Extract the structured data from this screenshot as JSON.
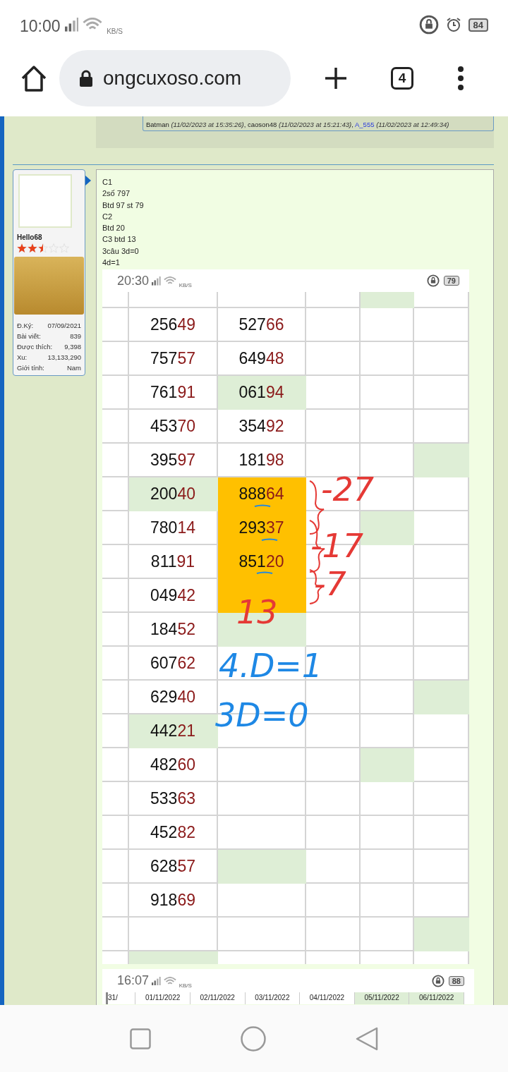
{
  "status_bar": {
    "time": "10:00",
    "speed_unit": "KB/S",
    "battery": "84"
  },
  "browser": {
    "url": "ongcuxoso.com",
    "tab_count": "4"
  },
  "likes": [
    {
      "user": "Batman",
      "time": "(11/02/2023 at 15:35:26)",
      "after": ",",
      "link": false
    },
    {
      "user": "caoson48",
      "time": "(11/02/2023 at 15:21:43)",
      "after": ",",
      "link": false
    },
    {
      "user": "A_555",
      "time": "(11/02/2023 at 12:49:34)",
      "link": true
    }
  ],
  "user": {
    "name": "Hello68",
    "stars": 2.5,
    "stats": [
      {
        "label": "Đ.Ký:",
        "value": "07/09/2021"
      },
      {
        "label": "Bài viết:",
        "value": "839"
      },
      {
        "label": "Được thích:",
        "value": "9,398"
      },
      {
        "label": "Xu:",
        "value": "13,133,290"
      },
      {
        "label": "Giới tính:",
        "value": "Nam"
      }
    ]
  },
  "post": {
    "lines": [
      "C1",
      "2số 797",
      "Btd 97 st 79",
      "C2",
      "Btd 20",
      "C3 btd 13",
      "3câu 3d=0",
      "4d=1"
    ],
    "screenshot": {
      "time": "20:30",
      "speed_unit": "KB/S",
      "battery": "79",
      "rows": [
        {
          "kind": "partial",
          "cells": [
            {},
            {},
            {},
            {
              "color": "#deeed6"
            },
            {}
          ]
        },
        {
          "kind": "full",
          "cells": [
            {
              "text": "25649"
            },
            {
              "text": "52766"
            },
            {},
            {},
            {}
          ]
        },
        {
          "kind": "full",
          "cells": [
            {
              "text": "75757"
            },
            {
              "text": "64948"
            },
            {},
            {},
            {}
          ]
        },
        {
          "kind": "full",
          "cells": [
            {
              "text": "76191"
            },
            {
              "text": "06194",
              "color": "#deeed6"
            },
            {},
            {},
            {}
          ]
        },
        {
          "kind": "full",
          "cells": [
            {
              "text": "45370"
            },
            {
              "text": "35492"
            },
            {},
            {},
            {}
          ]
        },
        {
          "kind": "full",
          "cells": [
            {
              "text": "39597"
            },
            {
              "text": "18198"
            },
            {},
            {},
            {
              "color": "#deeed6"
            }
          ]
        },
        {
          "kind": "full",
          "cells": [
            {
              "text": "20040",
              "color": "#deeed6"
            },
            {
              "text": "88864",
              "color": "#ffc000"
            },
            {},
            {},
            {}
          ]
        },
        {
          "kind": "full",
          "cells": [
            {
              "text": "78014"
            },
            {
              "text": "29337",
              "color": "#ffc000"
            },
            {},
            {
              "color": "#deeed6"
            },
            {}
          ]
        },
        {
          "kind": "full",
          "cells": [
            {
              "text": "81191"
            },
            {
              "text": "85120",
              "color": "#ffc000"
            },
            {},
            {},
            {}
          ]
        },
        {
          "kind": "full",
          "cells": [
            {
              "text": "04942"
            },
            {
              "color": "#ffc000"
            },
            {},
            {},
            {}
          ]
        },
        {
          "kind": "full",
          "cells": [
            {
              "text": "18452"
            },
            {
              "color": "#deeed6"
            },
            {},
            {},
            {}
          ]
        },
        {
          "kind": "full",
          "cells": [
            {
              "text": "60762"
            },
            {},
            {},
            {},
            {}
          ]
        },
        {
          "kind": "full",
          "cells": [
            {
              "text": "62940"
            },
            {},
            {},
            {},
            {
              "color": "#deeed6"
            }
          ]
        },
        {
          "kind": "full",
          "cells": [
            {
              "text": "44221",
              "color": "#deeed6"
            },
            {},
            {},
            {},
            {}
          ]
        },
        {
          "kind": "full",
          "cells": [
            {
              "text": "48260"
            },
            {},
            {},
            {
              "color": "#deeed6"
            },
            {}
          ]
        },
        {
          "kind": "full",
          "cells": [
            {
              "text": "53363"
            },
            {},
            {},
            {},
            {}
          ]
        },
        {
          "kind": "full",
          "cells": [
            {
              "text": "45282"
            },
            {},
            {},
            {},
            {}
          ]
        },
        {
          "kind": "full",
          "cells": [
            {
              "text": "62857"
            },
            {
              "color": "#deeed6"
            },
            {},
            {},
            {}
          ]
        },
        {
          "kind": "full",
          "cells": [
            {
              "text": "91869"
            },
            {},
            {},
            {},
            {}
          ]
        },
        {
          "kind": "full",
          "cells": [
            {},
            {},
            {},
            {},
            {
              "color": "#deeed6"
            }
          ]
        },
        {
          "kind": "partial",
          "cells": [
            {
              "color": "#deeed6"
            },
            {},
            {},
            {},
            {}
          ]
        }
      ],
      "notes": [
        {
          "text": "-27",
          "color": "#e53935"
        },
        {
          "text": "-17",
          "color": "#e53935"
        },
        {
          "text": "-7",
          "color": "#e53935"
        },
        {
          "text": "13",
          "color": "#e53935"
        },
        {
          "text": "4.D=1",
          "color": "#1e88e5"
        },
        {
          "text": "3D=0",
          "color": "#1e88e5"
        }
      ]
    },
    "screenshot_2": {
      "time": "16:07",
      "speed_unit": "KB/S",
      "battery": "88",
      "dates": [
        {
          "text": "31/"
        },
        {
          "text": "01/11/2022"
        },
        {
          "text": "02/11/2022"
        },
        {
          "text": "03/11/2022"
        },
        {
          "text": "04/11/2022"
        },
        {
          "text": "05/11/2022",
          "color": "#deeed6"
        },
        {
          "text": "06/11/2022",
          "color": "#deeed6"
        }
      ]
    }
  }
}
